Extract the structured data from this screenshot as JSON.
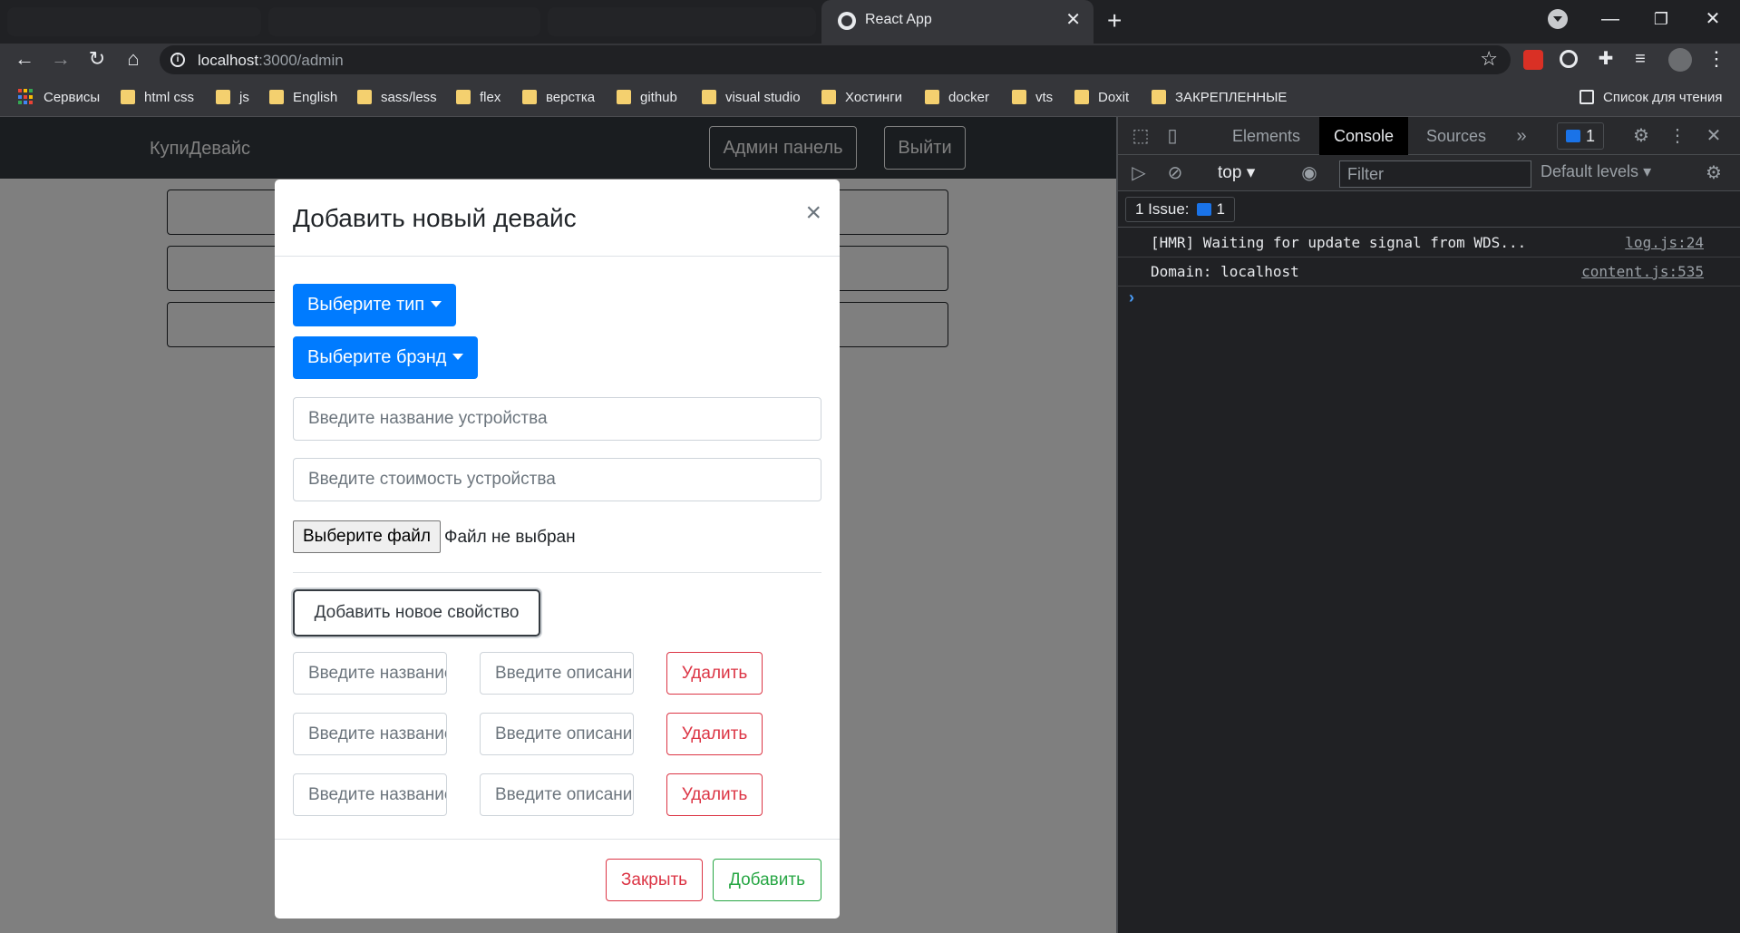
{
  "browser": {
    "active_tab_title": "React App",
    "url_host": "localhost",
    "url_path": ":3000/admin",
    "new_tab_symbol": "+"
  },
  "bookmarks": {
    "items": [
      "Сервисы",
      "html css",
      "js",
      "English",
      "sass/less",
      "flex",
      "верстка",
      "github",
      "visual studio",
      "Хостинги",
      "docker",
      "vts",
      "Doxit",
      "ЗАКРЕПЛЕННЫЕ"
    ],
    "reading_list": "Список для чтения"
  },
  "app": {
    "brand": "КупиДевайс",
    "admin_button": "Админ панель",
    "logout_button": "Выйти"
  },
  "modal": {
    "title": "Добавить новый девайс",
    "close_symbol": "×",
    "type_dropdown": "Выберите тип",
    "brand_dropdown": "Выберите брэнд",
    "name_placeholder": "Введите название устройства",
    "price_placeholder": "Введите стоимость устройства",
    "file_button": "Выберите файл",
    "file_status": "Файл не выбран",
    "add_property_button": "Добавить новое свойство",
    "properties": [
      {
        "title_placeholder": "Введите название",
        "description_placeholder": "Введите описание",
        "delete_label": "Удалить"
      },
      {
        "title_placeholder": "Введите название",
        "description_placeholder": "Введите описание",
        "delete_label": "Удалить"
      },
      {
        "title_placeholder": "Введите название",
        "description_placeholder": "Введите описание",
        "delete_label": "Удалить"
      }
    ],
    "footer": {
      "close_label": "Закрыть",
      "add_label": "Добавить"
    }
  },
  "devtools": {
    "tabs": [
      "Elements",
      "Console",
      "Sources"
    ],
    "active_tab": "Console",
    "more_tabs_symbol": "»",
    "message_count": "1",
    "context": "top",
    "filter_placeholder": "Filter",
    "levels": "Default levels",
    "issues_label": "1 Issue:",
    "issues_count": "1",
    "console": [
      {
        "text": "[HMR] Waiting for update signal from WDS...",
        "source": "log.js:24"
      },
      {
        "text": "Domain: localhost",
        "source": "content.js:535"
      }
    ],
    "prompt_symbol": "›"
  },
  "colors": {
    "primary": "#007bff",
    "danger": "#dc3545",
    "success": "#28a745",
    "navbar": "#343a40",
    "devtools_bg": "#202124"
  }
}
